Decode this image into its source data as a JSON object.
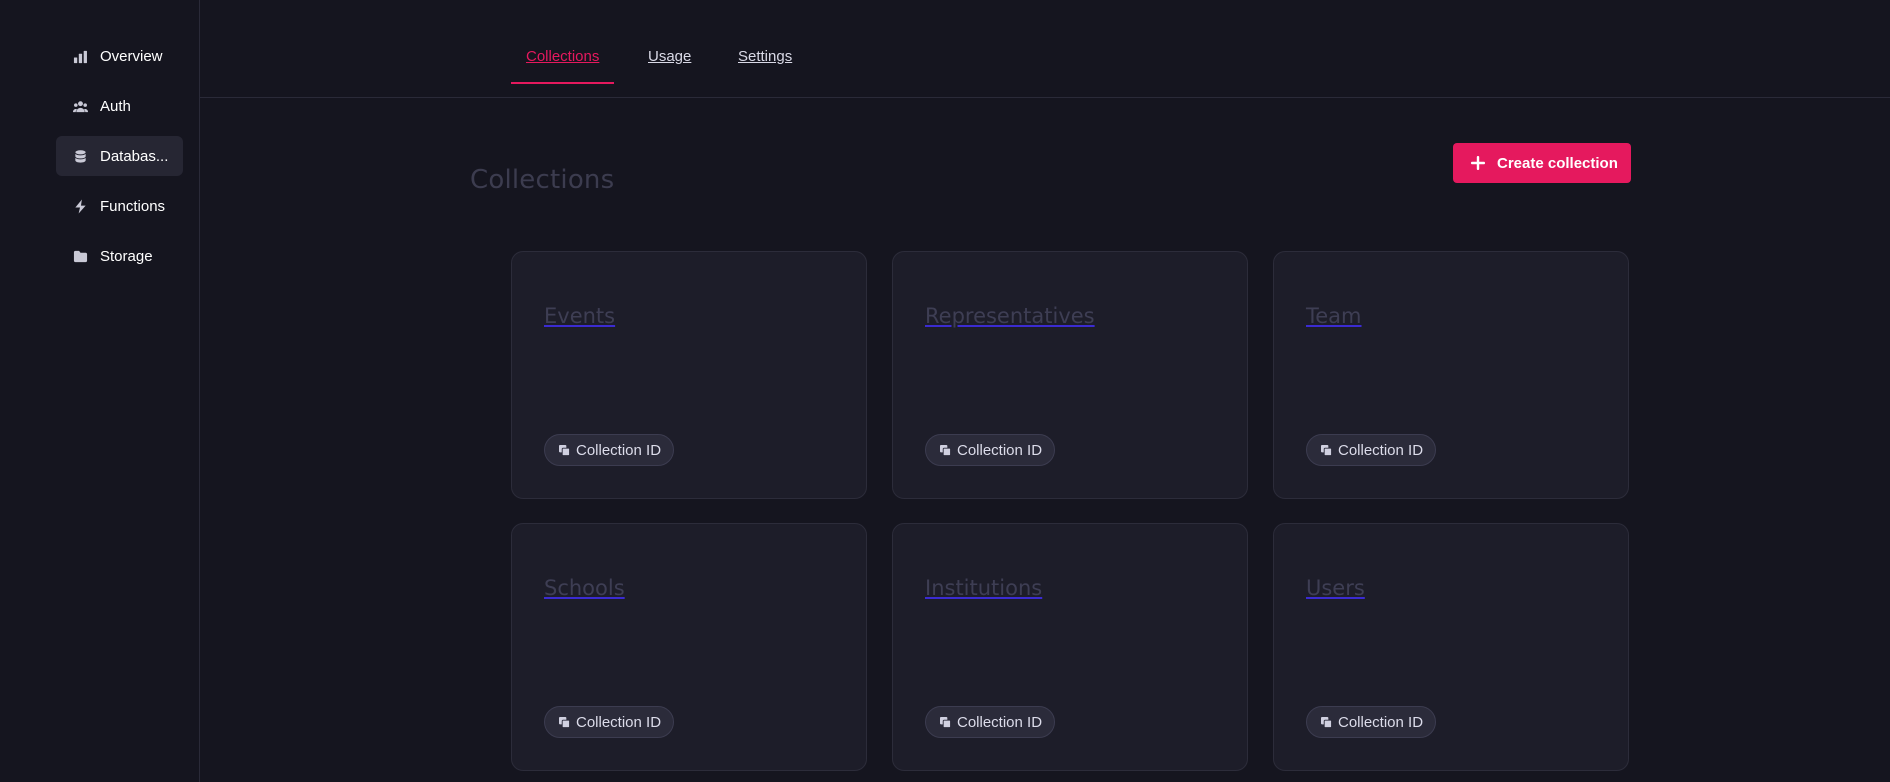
{
  "sidebar": {
    "items": [
      {
        "label": "Overview",
        "icon": "bar-chart-icon"
      },
      {
        "label": "Auth",
        "icon": "users-icon"
      },
      {
        "label": "Databas...",
        "icon": "database-icon",
        "active": true
      },
      {
        "label": "Functions",
        "icon": "lightning-icon"
      },
      {
        "label": "Storage",
        "icon": "folder-icon"
      }
    ]
  },
  "tabs": [
    {
      "label": "Collections",
      "active": true
    },
    {
      "label": "Usage"
    },
    {
      "label": "Settings"
    }
  ],
  "main": {
    "title": "Collections",
    "create_button": "Create collection",
    "collections": [
      {
        "name": "Events",
        "id_label": "Collection ID"
      },
      {
        "name": "Representatives",
        "id_label": "Collection ID"
      },
      {
        "name": "Team",
        "id_label": "Collection ID"
      },
      {
        "name": "Schools",
        "id_label": "Collection ID"
      },
      {
        "name": "Institutions",
        "id_label": "Collection ID"
      },
      {
        "name": "Users",
        "id_label": "Collection ID"
      }
    ]
  },
  "colors": {
    "accent": "#e5195e",
    "background": "#15151f",
    "card": "#1d1d29"
  }
}
